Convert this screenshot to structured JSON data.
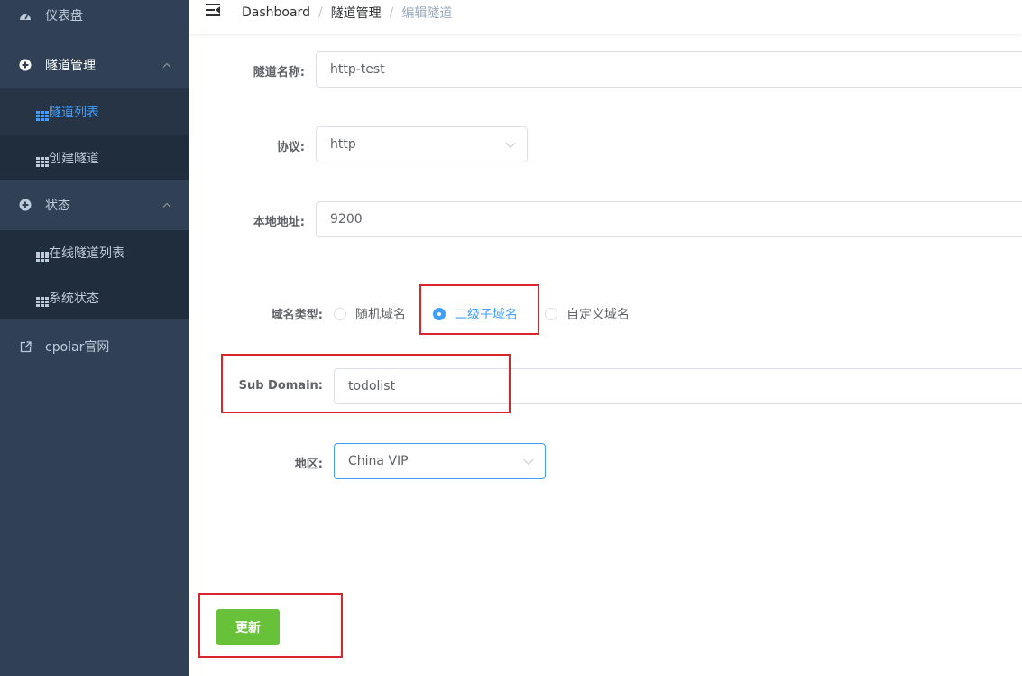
{
  "sidebar": {
    "dashboard_label": "仪表盘",
    "tunnel_mgmt_label": "隧道管理",
    "tunnel_list_label": "隧道列表",
    "create_tunnel_label": "创建隧道",
    "status_label": "状态",
    "online_tunnels_label": "在线隧道列表",
    "system_status_label": "系统状态",
    "cpolar_site_label": "cpolar官网",
    "active_color": "#409eff"
  },
  "breadcrumb": {
    "items": [
      "Dashboard",
      "隧道管理",
      "编辑隧道"
    ]
  },
  "form": {
    "tunnel_name_label": "隧道名称:",
    "tunnel_name_value": "http-test",
    "protocol_label": "协议:",
    "protocol_value": "http",
    "local_addr_label": "本地地址:",
    "local_addr_value": "9200",
    "domain_type_label": "域名类型:",
    "domain_type_options": [
      "随机域名",
      "二级子域名",
      "自定义域名"
    ],
    "domain_type_selected": "二级子域名",
    "subdomain_label": "Sub Domain:",
    "subdomain_value": "todolist",
    "region_label": "地区:",
    "region_value": "China VIP",
    "update_label": "更新"
  },
  "colors": {
    "sidebar_bg": "#304156",
    "highlight_box": "#d9262c",
    "update_button": "#67c23a"
  }
}
